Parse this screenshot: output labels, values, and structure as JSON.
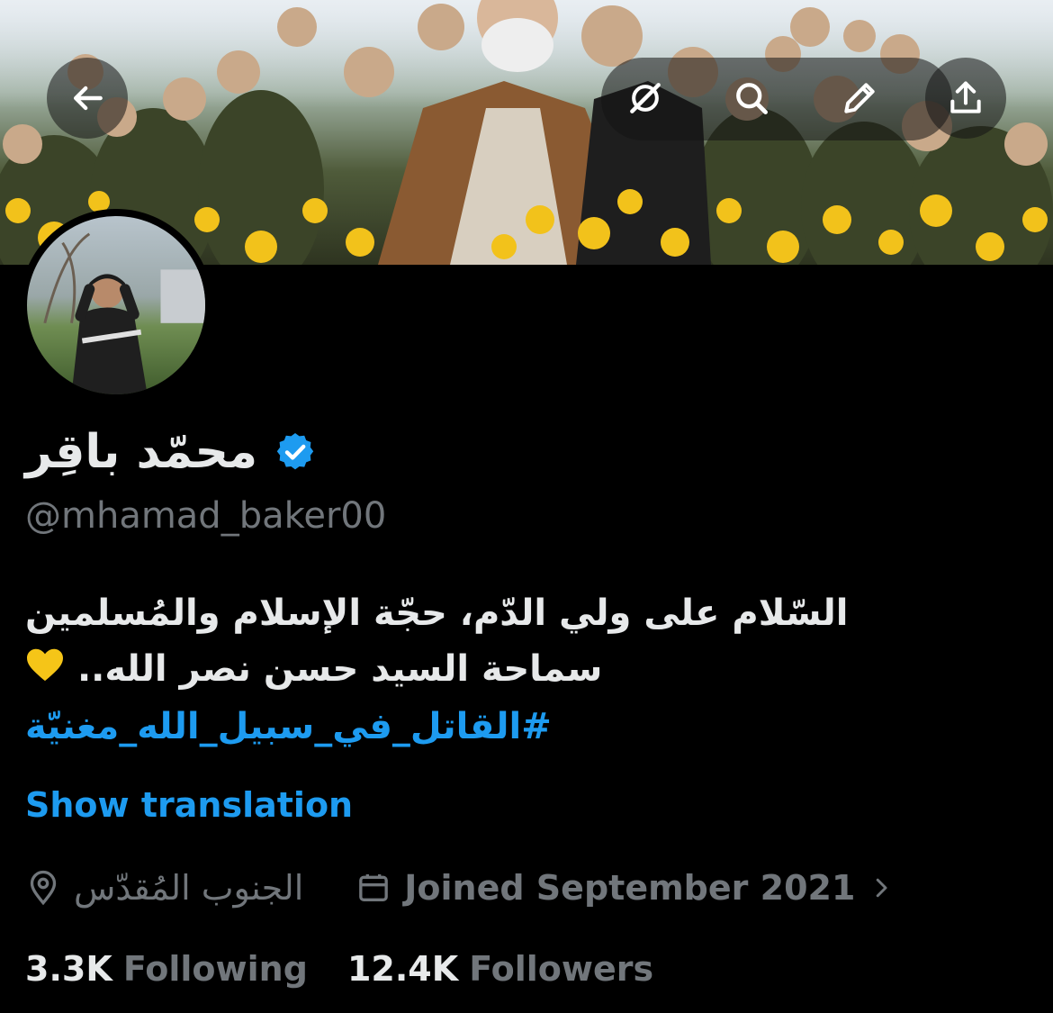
{
  "header": {
    "back_icon": "arrow-left-icon",
    "grok_icon": "grok-icon",
    "search_icon": "search-icon",
    "edit_icon": "pencil-icon",
    "share_icon": "share-upload-icon"
  },
  "profile": {
    "display_name": "محمّد باقِر",
    "verified": true,
    "handle": "@mhamad_baker00",
    "bio_lines": [
      "السّلام على ولي الدّم، حجّة الإسلام والمُسلمين",
      "سماحة السيد حسن نصر الله.."
    ],
    "bio_hashtag": "#القاتل_في_سبيل_الله_مغنيّة",
    "show_translation": "Show translation",
    "location": "الجنوب المُقدّس",
    "joined": "Joined September 2021",
    "following_count": "3.3K",
    "following_label": "Following",
    "followers_count": "12.4K",
    "followers_label": "Followers"
  },
  "colors": {
    "accent": "#1d9bf0",
    "muted": "#71767b",
    "text": "#e7e9ea",
    "background": "#000000",
    "heart": "#f5c518"
  }
}
